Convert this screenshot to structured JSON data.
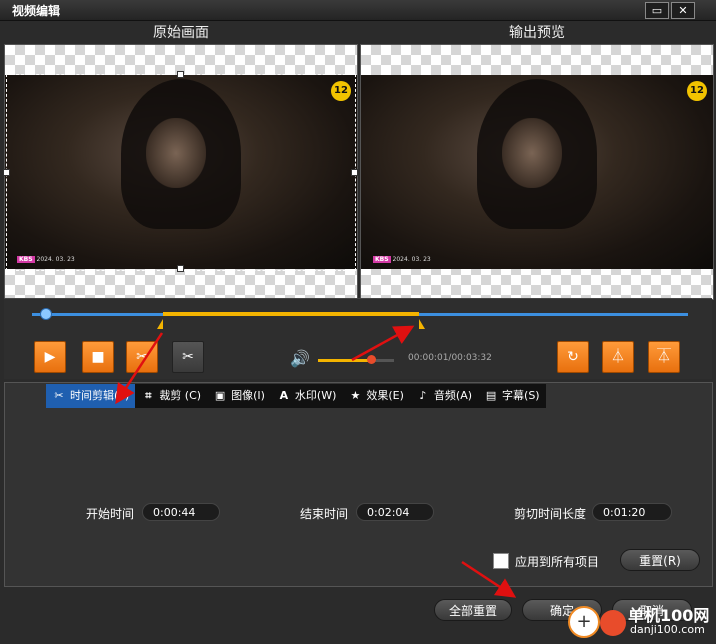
{
  "window": {
    "title": "视频编辑",
    "restore_icon": "restore-icon",
    "close_icon": "close-icon"
  },
  "panels": {
    "original_label": "原始画面",
    "output_label": "输出预览"
  },
  "video": {
    "badge": "12",
    "watermark_brand": "KBS",
    "watermark_date": "2024. 03. 23"
  },
  "player": {
    "time": "00:00:01/00:03:32",
    "volume_percent": 70,
    "progress_percent": 2,
    "trim_start_percent": 20,
    "trim_end_percent": 59
  },
  "tabs": [
    {
      "label": "时间剪辑(T)",
      "icon": "scissors-icon",
      "active": true
    },
    {
      "label": "裁剪 (C)",
      "icon": "crop-icon"
    },
    {
      "label": "图像(I)",
      "icon": "image-icon"
    },
    {
      "label": "水印(W)",
      "icon": "watermark-icon"
    },
    {
      "label": "效果(E)",
      "icon": "star-icon"
    },
    {
      "label": "音频(A)",
      "icon": "music-icon"
    },
    {
      "label": "字幕(S)",
      "icon": "subtitle-icon"
    }
  ],
  "trim": {
    "start_label": "开始时间",
    "start_value": "0:00:44",
    "end_label": "结束时间",
    "end_value": "0:02:04",
    "length_label": "剪切时间长度",
    "length_value": "0:01:20"
  },
  "apply_all_label": "应用到所有项目",
  "reset_label": "重置(R)",
  "footer": {
    "reset_all": "全部重置",
    "ok": "确定",
    "cancel": "取消"
  },
  "site_watermark": {
    "name": "单机100网",
    "url": "danji100.com"
  },
  "colors": {
    "accent_orange": "#f08a24",
    "timeline_blue": "#3c8fe0",
    "trim_yellow": "#f4b400",
    "tab_active": "#1f5fb0"
  }
}
